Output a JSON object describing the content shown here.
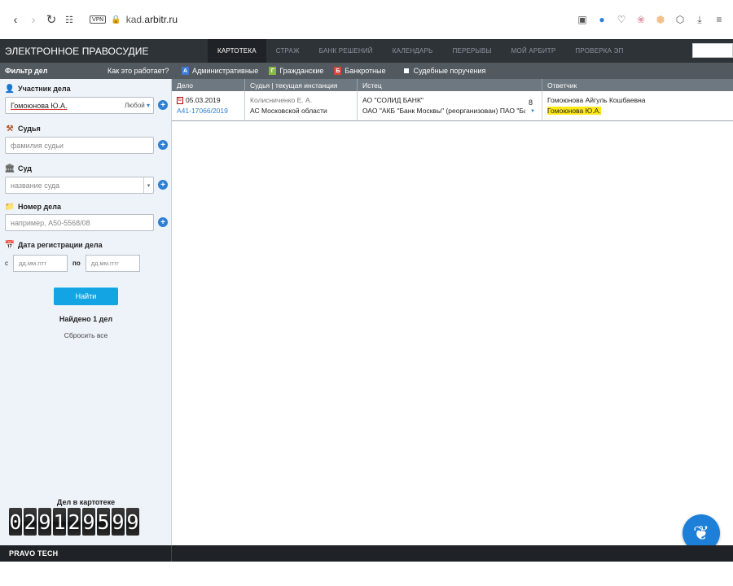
{
  "browser": {
    "vpn": "VPN",
    "url_domain": "kad.",
    "url_rest": "arbitr.ru"
  },
  "header": {
    "title": "ЭЛЕКТРОННОЕ ПРАВОСУДИЕ",
    "tabs": [
      "КАРТОТЕКА",
      "СТРАЖ",
      "БАНК РЕШЕНИЙ",
      "КАЛЕНДАРЬ",
      "ПЕРЕРЫВЫ",
      "МОЙ АРБИТР",
      "ПРОВЕРКА ЭП"
    ],
    "active_tab": "КАРТОТЕКА"
  },
  "subheader": {
    "filter_title": "Фильтр дел",
    "how_works": "Как это работает?",
    "categories": [
      {
        "icon": "А",
        "label": "Административные"
      },
      {
        "icon": "Г",
        "label": "Гражданские"
      },
      {
        "icon": "Б",
        "label": "Банкротные"
      },
      {
        "icon": "",
        "label": "Судебные поручения"
      }
    ]
  },
  "sidebar": {
    "participant": {
      "label": "Участник дела",
      "value": "Гомоюнова Ю.А.",
      "role": "Любой"
    },
    "judge": {
      "label": "Судья",
      "placeholder": "фамилия судьи"
    },
    "court": {
      "label": "Суд",
      "placeholder": "название суда"
    },
    "case_number": {
      "label": "Номер дела",
      "placeholder": "например, А50-5568/08"
    },
    "reg_date": {
      "label": "Дата регистрации дела",
      "from_label": "с",
      "to_label": "по",
      "from_placeholder": "дд.мм.гггг",
      "to_placeholder": "дд.мм.гггг"
    },
    "find_button": "Найти",
    "found_text": "Найдено 1 дел",
    "reset_text": "Сбросить все",
    "counter_label": "Дел в картотеке",
    "counter_digits": [
      "0",
      "2",
      "9",
      "1",
      "2",
      "9",
      "5",
      "9",
      "9"
    ]
  },
  "table": {
    "headers": [
      "Дело",
      "Судья | текущая инстанция",
      "Истец",
      "Ответчик"
    ],
    "rows": [
      {
        "doc_icon": "Б",
        "date": "05.03.2019",
        "case_number": "А41-17066/2019",
        "judge": "Колисниченко Е. А.",
        "court": "АС Московской области",
        "plaintiff_1": "АО \"СОЛИД БАНК\"",
        "plaintiff_2": "ОАО \"АКБ \"Банк Москвы\" (реорганизован) ПАО \"Ба",
        "plaintiff_count": "8",
        "defendant_1": "Гомоюнова Айгуль Кошбаевна",
        "defendant_2": "Гомоюнова Ю.А."
      }
    ]
  },
  "footer": {
    "brand": "PRAVO TECH"
  }
}
